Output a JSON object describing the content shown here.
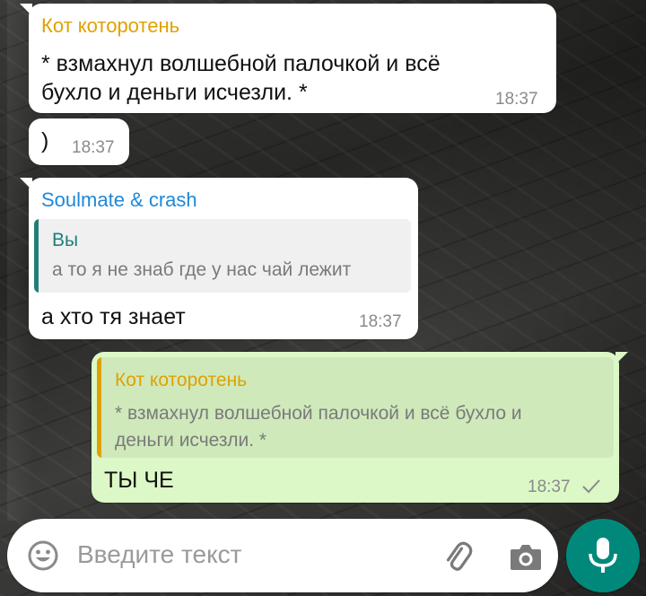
{
  "colors": {
    "incoming_bubble": "#ffffff",
    "outgoing_bubble": "#dcf8c6",
    "sender_orange": "#e0a100",
    "sender_blue": "#1e88d9",
    "quote_bar_teal": "#1f7f78",
    "quote_bar_orange": "#e0a100",
    "mic_button": "#00897b"
  },
  "messages": [
    {
      "sender": "Кот которотень",
      "text_lines": [
        "* взмахнул волшебной палочкой и всё",
        "бухло и деньги исчезли. *"
      ],
      "time": "18:37"
    },
    {
      "text": ")",
      "time": "18:37"
    },
    {
      "sender": "Soulmate & crash",
      "quote": {
        "sender": "Вы",
        "text": "а то я не знаб где у нас чай лежит"
      },
      "text": "а хто тя знает",
      "time": "18:37"
    },
    {
      "quote": {
        "sender": "Кот которотень",
        "text_lines": [
          "* взмахнул волшебной палочкой и всё бухло и",
          "деньги исчезли. *"
        ]
      },
      "text": "ТЫ ЧЕ",
      "time": "18:37",
      "status_icon": "single-check-icon"
    }
  ],
  "composer": {
    "placeholder": "Введите текст",
    "emoji_icon": "emoji-icon",
    "attach_icon": "paperclip-icon",
    "camera_icon": "camera-icon",
    "mic_icon": "microphone-icon"
  }
}
